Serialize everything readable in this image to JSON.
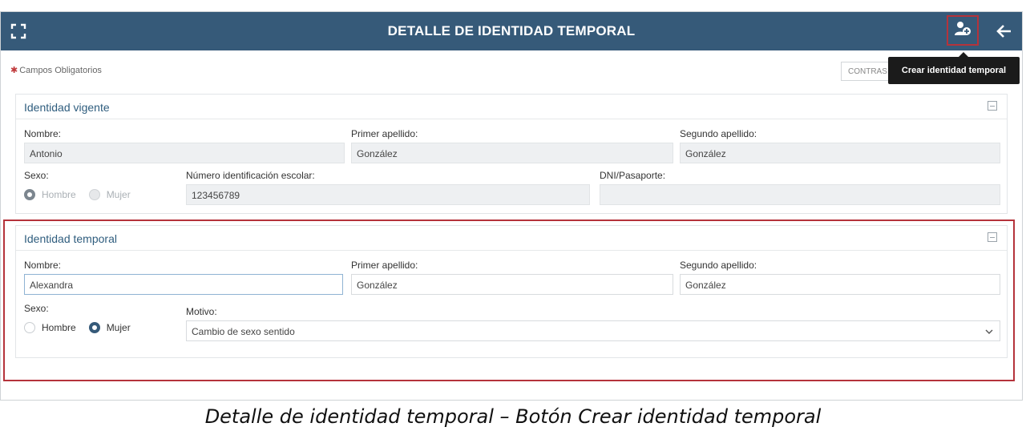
{
  "header": {
    "title": "DETALLE DE IDENTIDAD TEMPORAL",
    "expand_icon": "expand-icon",
    "create_icon": "user-plus-icon",
    "back_icon": "arrow-left-icon"
  },
  "required_note": "Campos Obligatorios",
  "contrast_button": "CONTRAS",
  "tooltip": "Crear identidad temporal",
  "vigente": {
    "title": "Identidad vigente",
    "nombre_label": "Nombre:",
    "nombre_value": "Antonio",
    "primer_label": "Primer apellido:",
    "primer_value": "González",
    "segundo_label": "Segundo apellido:",
    "segundo_value": "González",
    "sexo_label": "Sexo:",
    "sexo_options": [
      "Hombre",
      "Mujer"
    ],
    "nie_label": "Número identificación escolar:",
    "nie_value": "123456789",
    "dni_label": "DNI/Pasaporte:",
    "dni_value": ""
  },
  "temporal": {
    "title": "Identidad temporal",
    "nombre_label": "Nombre:",
    "nombre_value": "Alexandra",
    "primer_label": "Primer apellido:",
    "primer_value": "González",
    "segundo_label": "Segundo apellido:",
    "segundo_value": "González",
    "sexo_label": "Sexo:",
    "sexo_options": [
      "Hombre",
      "Mujer"
    ],
    "motivo_label": "Motivo:",
    "motivo_value": "Cambio de sexo sentido"
  },
  "caption": "Detalle de identidad temporal – Botón Crear identidad temporal",
  "colors": {
    "header": "#365a79",
    "accent_border": "#b5333b",
    "required": "#c0393b"
  }
}
